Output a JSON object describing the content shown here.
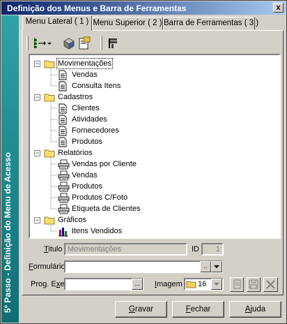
{
  "window": {
    "title": "Definição dos Menus e Barra de Ferramentas",
    "close_label": "x"
  },
  "sidebar": {
    "text": "5º Passo - Definição do Menu de Acesso"
  },
  "tabs": [
    {
      "label": "Menu Lateral ( 1 )",
      "active": true
    },
    {
      "label": "Menu Superior ( 2 )",
      "active": false
    },
    {
      "label": "Barra de Ferramentas ( 3 )",
      "active": false
    }
  ],
  "toolbar": {
    "icons": [
      "add-item-icon",
      "dropdown-arrow-icon",
      "cube-icon",
      "edit-icon",
      "properties-icon"
    ]
  },
  "tree": {
    "groups": [
      {
        "label": "Movimentações",
        "expanded": true,
        "selected": true,
        "items": [
          {
            "label": "Vendas",
            "icon": "document-icon"
          },
          {
            "label": "Consulta Itens",
            "icon": "document-icon"
          }
        ]
      },
      {
        "label": "Cadastros",
        "expanded": true,
        "selected": false,
        "items": [
          {
            "label": "Clientes",
            "icon": "document-icon"
          },
          {
            "label": "Atividades",
            "icon": "document-icon"
          },
          {
            "label": "Fornecedores",
            "icon": "document-icon"
          },
          {
            "label": "Produtos",
            "icon": "document-icon"
          }
        ]
      },
      {
        "label": "Relatórios",
        "expanded": true,
        "selected": false,
        "items": [
          {
            "label": "Vendas por Cliente",
            "icon": "printer-icon"
          },
          {
            "label": "Vendas",
            "icon": "printer-icon"
          },
          {
            "label": "Produtos",
            "icon": "printer-icon"
          },
          {
            "label": "Produtos C/Foto",
            "icon": "printer-icon"
          },
          {
            "label": "Etiqueta de Clientes",
            "icon": "printer-icon"
          }
        ]
      },
      {
        "label": "Gráficos",
        "expanded": true,
        "selected": false,
        "items": [
          {
            "label": "Itens Vendidos",
            "icon": "bar-chart-icon"
          }
        ]
      }
    ]
  },
  "form": {
    "titulo_label": "Titulo",
    "titulo_value": "Movimentações",
    "id_label": "ID",
    "id_value": "1",
    "formulario_label": "Formulário",
    "formulario_value": "",
    "formulario_ellipsis": "..",
    "prog_label": "Prog. Exe",
    "prog_value": "",
    "prog_ellipsis": "...",
    "imagem_label": "Imagem",
    "imagem_value": "16"
  },
  "buttons": {
    "gravar": "Gravar",
    "fechar": "Fechar",
    "ajuda": "Ajuda"
  }
}
